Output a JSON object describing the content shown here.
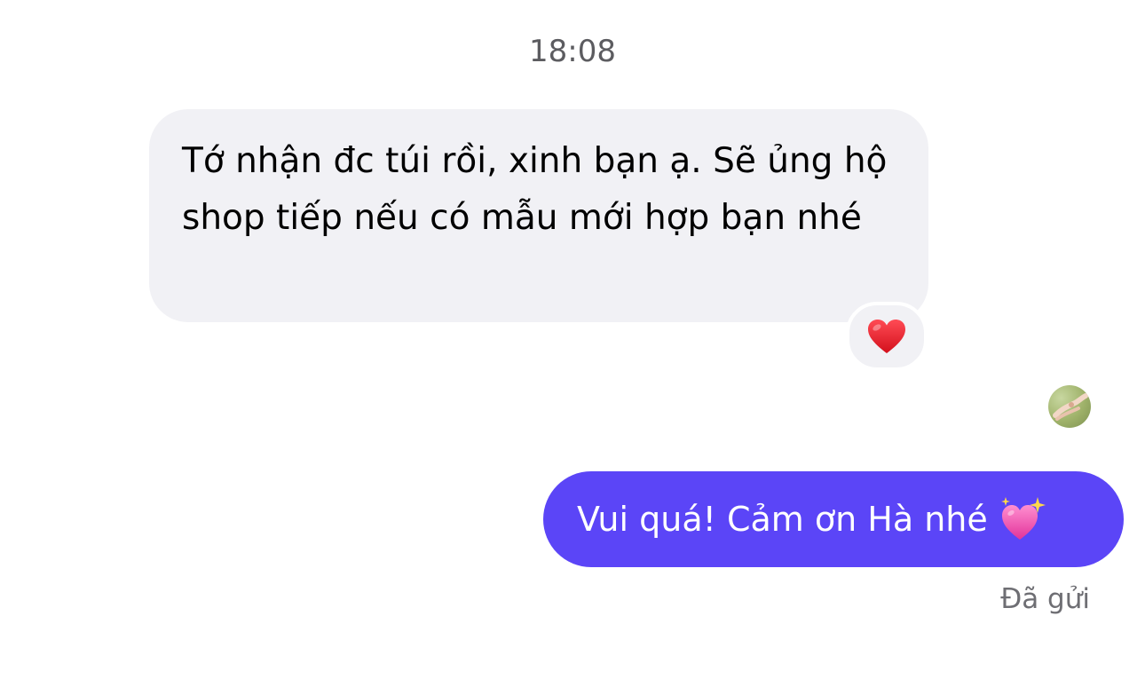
{
  "conversation": {
    "timestamp": "18:08",
    "incoming_message": {
      "text": "Tớ nhận đc túi rồi, xinh bạn ạ. Sẽ ủng hộ shop tiếp nếu có mẫu mới hợp bạn nhé",
      "reaction": "heart-reaction-icon"
    },
    "outgoing_message": {
      "text": "Vui quá! Cảm ơn Hà nhé",
      "emoji": "sparkling-heart-icon",
      "status": "Đã gửi"
    },
    "colors": {
      "incoming_bubble": "#f1f1f5",
      "outgoing_bubble": "#5b45f7",
      "outgoing_text": "#ffffff",
      "timestamp_text": "#5c5c60",
      "status_text": "#6e6e73",
      "reaction_heart": "#e0222f"
    }
  }
}
